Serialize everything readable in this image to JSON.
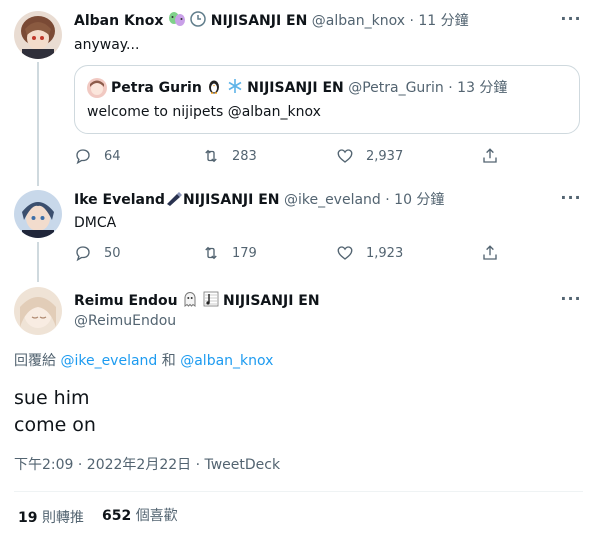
{
  "tweets": [
    {
      "name": "Alban Knox",
      "badge_text": "NIJISANJI EN",
      "handle": "@alban_knox",
      "separator": "·",
      "time": "11 分鐘",
      "text": "anyway...",
      "quote": {
        "name": "Petra Gurin",
        "badge_text": "NIJISANJI EN",
        "handle": "@Petra_Gurin",
        "separator": "·",
        "time": "13 分鐘",
        "text": "welcome to nijipets @alban_knox"
      },
      "stats": {
        "replies": "64",
        "retweets": "283",
        "likes": "2,937"
      }
    },
    {
      "name": "Ike Eveland",
      "badge_text": "NIJISANJI EN",
      "handle": "@ike_eveland",
      "separator": "·",
      "time": "10 分鐘",
      "text": "DMCA",
      "stats": {
        "replies": "50",
        "retweets": "179",
        "likes": "1,923"
      }
    }
  ],
  "main_tweet": {
    "name": "Reimu Endou",
    "badge_text": "NIJISANJI EN",
    "handle": "@ReimuEndou",
    "reply_prefix": "回覆給",
    "reply_to_1": "@ike_eveland",
    "reply_and": "和",
    "reply_to_2": "@alban_knox",
    "text_line1": "sue him",
    "text_line2": "come on",
    "timestamp": "下午2:09 · 2022年2月22日 · TweetDeck",
    "retweet_count": "19",
    "retweet_label": "則轉推",
    "like_count": "652",
    "like_label": "個喜歡"
  },
  "icons": [
    "more-icon",
    "reply-icon",
    "retweet-icon",
    "like-icon",
    "share-icon"
  ],
  "colors": {
    "link": "#1d9bf0",
    "muted": "#536471",
    "border": "#cfd9de"
  }
}
